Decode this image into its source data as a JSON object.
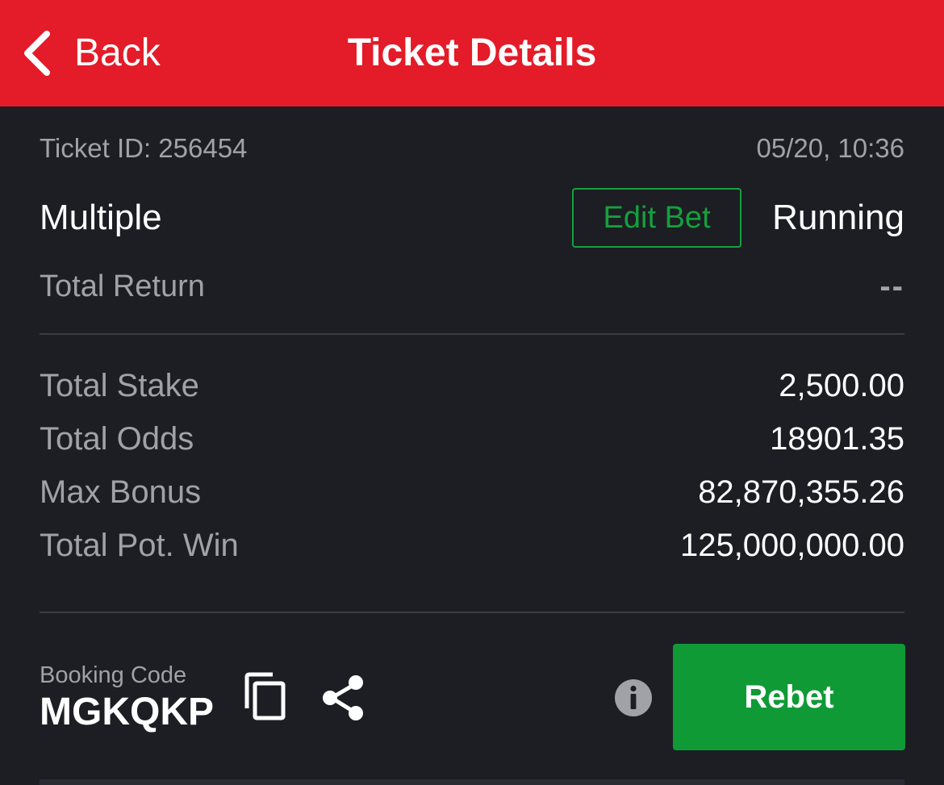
{
  "header": {
    "back_label": "Back",
    "title": "Ticket Details"
  },
  "ticket": {
    "id_text": "Ticket ID: 256454",
    "datetime": "05/20, 10:36",
    "type": "Multiple",
    "edit_bet_label": "Edit Bet",
    "status": "Running",
    "total_return_label": "Total Return",
    "total_return_value": "--"
  },
  "stats": [
    {
      "label": "Total Stake",
      "value": "2,500.00"
    },
    {
      "label": "Total Odds",
      "value": "18901.35"
    },
    {
      "label": "Max Bonus",
      "value": "82,870,355.26"
    },
    {
      "label": "Total Pot. Win",
      "value": "125,000,000.00"
    }
  ],
  "booking": {
    "label": "Booking Code",
    "code": "MGKQKP"
  },
  "actions": {
    "rebet_label": "Rebet"
  },
  "colors": {
    "header_bg": "#e41b28",
    "page_bg": "#1c1e24",
    "accent_green": "#15a03c",
    "rebet_bg": "#0f9a36"
  },
  "icons": [
    "chevron-left-icon",
    "copy-icon",
    "share-icon",
    "info-icon"
  ]
}
